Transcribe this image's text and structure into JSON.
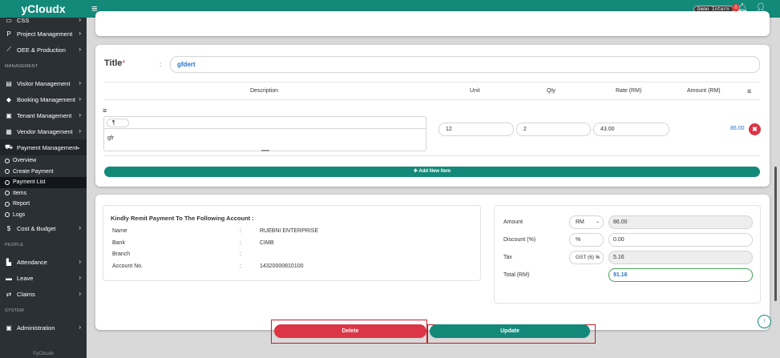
{
  "app": {
    "brand": "yCloudx",
    "footer": "©yCloudx"
  },
  "topbar": {
    "user_chip": "Demo Intern",
    "notification_count": "0"
  },
  "sidebar": {
    "items_top": [
      {
        "label": "CSS",
        "icon": "css-icon"
      },
      {
        "label": "Project Management",
        "icon": "project-icon"
      },
      {
        "label": "OEE & Production",
        "icon": "chart-line-icon"
      }
    ],
    "section_management": "MANAGEMENT",
    "items_management": [
      {
        "label": "Visitor Management",
        "icon": "id-card-icon"
      },
      {
        "label": "Booking Management",
        "icon": "tag-icon"
      },
      {
        "label": "Tenant Management",
        "icon": "building-icon"
      },
      {
        "label": "Vendor Management",
        "icon": "vendor-icon"
      },
      {
        "label": "Payment Management",
        "icon": "cart-icon"
      }
    ],
    "payment_sub": [
      "Overview",
      "Create Payment",
      "Payment List",
      "Items",
      "Report",
      "Logs"
    ],
    "cost_budget": "Cost & Budget",
    "section_people": "PEOPLE",
    "items_people": [
      {
        "label": "Attendance",
        "icon": "attendance-icon"
      },
      {
        "label": "Leave",
        "icon": "leave-icon"
      },
      {
        "label": "Claims",
        "icon": "claims-icon"
      }
    ],
    "section_system": "SYSTEM",
    "administration": "Administration"
  },
  "form": {
    "title_label": "Title",
    "required_mark": "*",
    "title_colon": ":",
    "title_value": "gfdert",
    "columns": {
      "description": "Description",
      "unit": "Unit",
      "qty": "Qty",
      "rate": "Rate (RM)",
      "amount": "Amount (RM)"
    },
    "row": {
      "para_symbol": "¶",
      "description": "gfr",
      "unit": "12",
      "qty": "2",
      "rate": "43.00",
      "amount": "86.00"
    },
    "add_item_label": "Add New Item"
  },
  "remit": {
    "title": "Kindly Remit Payment To The Following Account :",
    "rows": [
      {
        "key": "Name",
        "value": "RUEBNI ENTERPRISE"
      },
      {
        "key": "Bank",
        "value": "CIMB"
      },
      {
        "key": "Branch",
        "value": ""
      },
      {
        "key": "Account No.",
        "value": "14320000810100"
      }
    ],
    "colon": ":"
  },
  "totals": {
    "amount_label": "Amount",
    "amount_currency": "RM",
    "amount_value": "86.00",
    "discount_label": "Discount (%)",
    "discount_unit": "%",
    "discount_value": "0.00",
    "tax_label": "Tax",
    "tax_option": "GST (6) %",
    "tax_value": "5.16",
    "total_label": "Total (RM)",
    "total_value": "91.16"
  },
  "actions": {
    "delete": "Delete",
    "update": "Update"
  }
}
